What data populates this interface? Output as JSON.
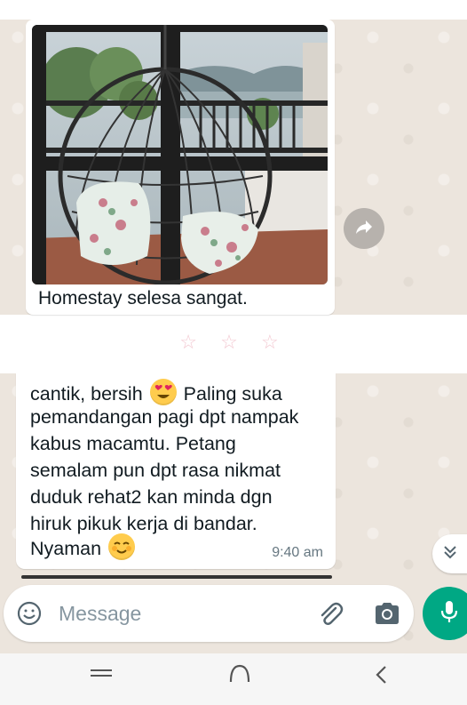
{
  "chat": {
    "image_message": {
      "caption": "Homestay selesa sangat."
    },
    "divider": "☆ ☆ ☆",
    "text_message": {
      "lines": [
        "cantik, bersih",
        "Paling suka",
        "pemandangan pagi dpt nampak",
        "kabus macamtu. Petang",
        "semalam pun dpt rasa nikmat",
        "duduk rehat2 kan minda dgn",
        "hiruk pikuk kerja di bandar.",
        "Nyaman"
      ],
      "time": "9:40 am"
    }
  },
  "composer": {
    "placeholder": "Message"
  },
  "icons": {
    "forward": "forward-arrow-icon",
    "scroll_down": "double-chevron-down-icon",
    "emoji": "smiley-icon",
    "attach": "paperclip-icon",
    "camera": "camera-icon",
    "mic": "microphone-icon",
    "nav_recents": "recents-icon",
    "nav_home": "home-icon",
    "nav_back": "back-icon"
  },
  "colors": {
    "wallpaper": "#ece5dd",
    "bubble": "#ffffff",
    "accent": "#00a884",
    "emoji": "#ffcc4d"
  }
}
